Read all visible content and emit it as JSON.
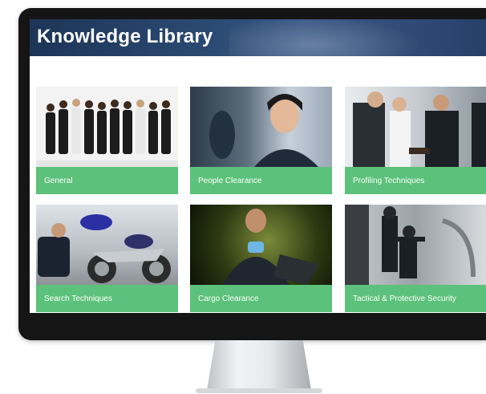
{
  "header": {
    "title": "Knowledge Library"
  },
  "tiles": [
    {
      "label": "General",
      "image": "uniformed-staff-group-photo"
    },
    {
      "label": "People Clearance",
      "image": "officer-portrait-photo"
    },
    {
      "label": "Profiling Techniques",
      "image": "officer-checking-document-photo"
    },
    {
      "label": "Search Techniques",
      "image": "officer-inspecting-motorcycle-photo"
    },
    {
      "label": "Cargo Clearance",
      "image": "officer-with-tablet-photo"
    },
    {
      "label": "Tactical & Protective Security",
      "image": "armed-officers-training-photo"
    }
  ],
  "colors": {
    "tile_label_bg": "#5cc17a",
    "header_bg": "#2b4a73"
  }
}
